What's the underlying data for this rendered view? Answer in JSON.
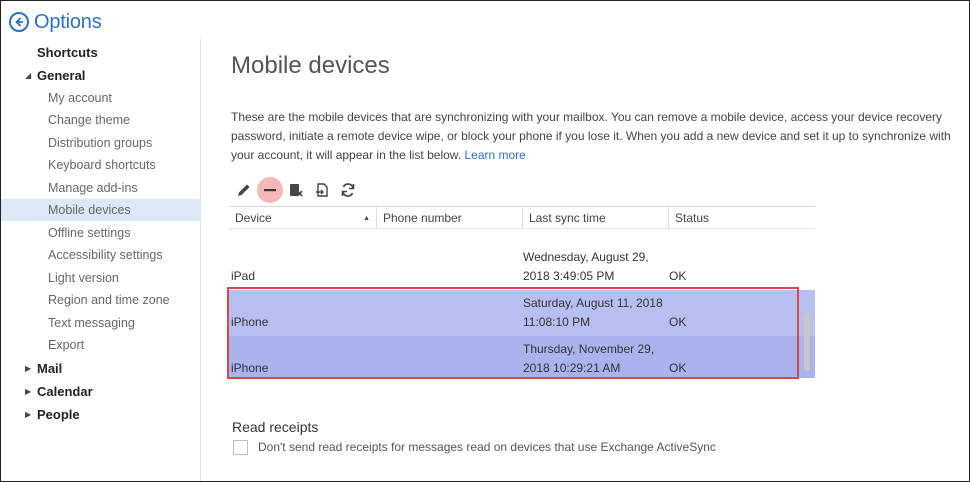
{
  "header": {
    "title": "Options",
    "back_icon": "back-arrow-circle-icon"
  },
  "sidebar": {
    "shortcuts": "Shortcuts",
    "general": "General",
    "general_items": [
      "My account",
      "Change theme",
      "Distribution groups",
      "Keyboard shortcuts",
      "Manage add-ins",
      "Mobile devices",
      "Offline settings",
      "Accessibility settings",
      "Light version",
      "Region and time zone",
      "Text messaging",
      "Export"
    ],
    "selected": "Mobile devices",
    "mail": "Mail",
    "calendar": "Calendar",
    "people": "People"
  },
  "main": {
    "title": "Mobile devices",
    "description": "These are the mobile devices that are synchronizing with your mailbox. You can remove a mobile device, access your device recovery password, initiate a remote device wipe, or block your phone if you lose it. When you add a new device and set it up to synchronize with your account, it will appear in the list below.",
    "learn_more": "Learn more",
    "toolbar": [
      "pencil-icon",
      "minus-icon",
      "wipe-device-icon",
      "export-device-icon",
      "refresh-icon"
    ],
    "table": {
      "columns": [
        "Device",
        "Phone number",
        "Last sync time",
        "Status"
      ],
      "rows": [
        {
          "device": "iPad",
          "phone": "",
          "sync_line1": "Wednesday, August 29,",
          "sync_line2": "2018 3:49:05 PM",
          "status": "OK",
          "selected": false
        },
        {
          "device": "iPhone",
          "phone": "",
          "sync_line1": "Saturday, August 11, 2018",
          "sync_line2": "11:08:10 PM",
          "status": "OK",
          "selected": true
        },
        {
          "device": "iPhone",
          "phone": "",
          "sync_line1": "Thursday, November 29,",
          "sync_line2": "2018 10:29:21 AM",
          "status": "OK",
          "selected": true
        }
      ]
    },
    "read_receipts": {
      "title": "Read receipts",
      "checkbox_label": "Don't send read receipts for messages read on devices that use Exchange ActiveSync",
      "checked": false
    }
  },
  "colors": {
    "accent": "#2a72c8",
    "selection": "#b7bff0",
    "highlight_box": "#d9474c"
  }
}
